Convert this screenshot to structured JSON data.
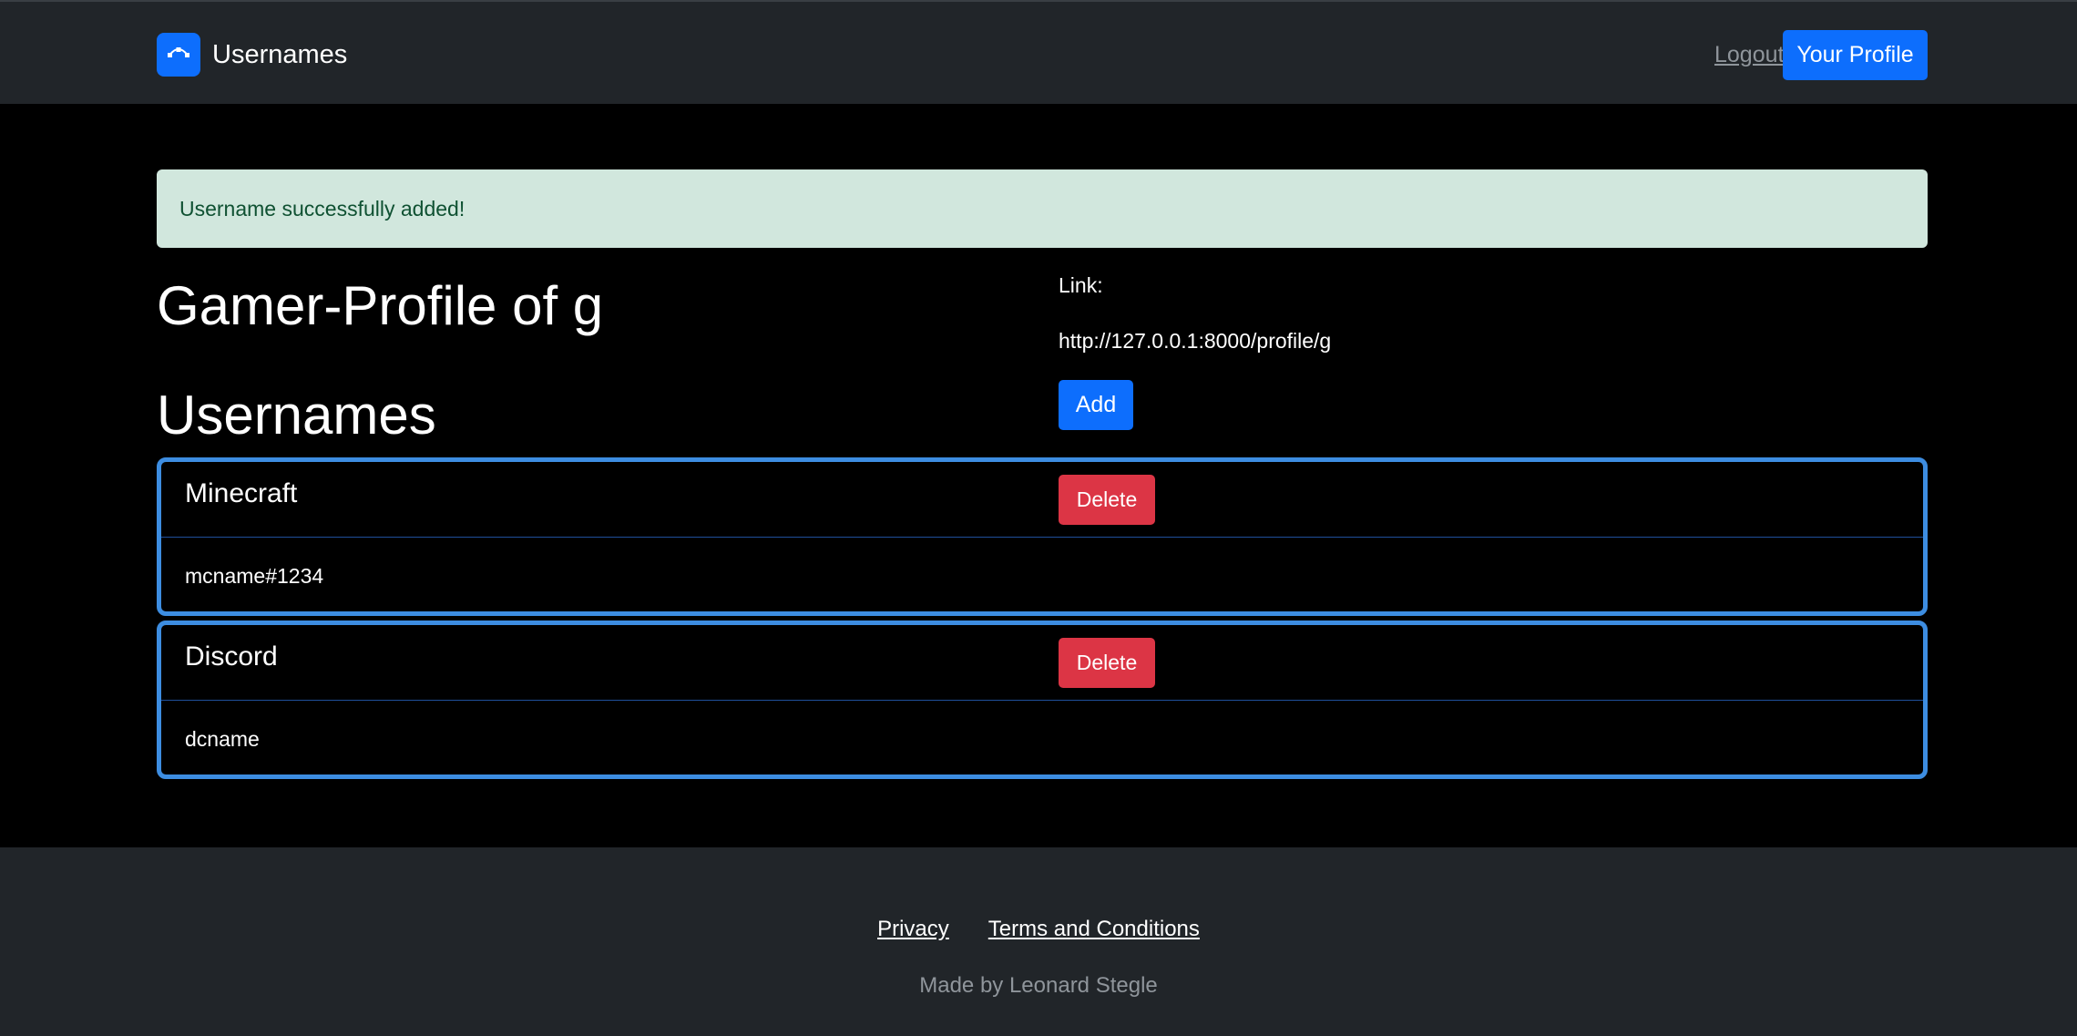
{
  "navbar": {
    "brand_name": "Usernames",
    "brand_icon": "bezier-curve-icon",
    "logout_label": "Logout",
    "profile_button_label": "Your Profile"
  },
  "alert": {
    "message": "Username successfully added!"
  },
  "profile": {
    "title": "Gamer-Profile of g",
    "link_label": "Link:",
    "link_url": "http://127.0.0.1:8000/profile/g",
    "add_button_label": "Add"
  },
  "usernames": {
    "heading": "Usernames",
    "items": [
      {
        "platform": "Minecraft",
        "username": "mcname#1234",
        "delete_label": "Delete"
      },
      {
        "platform": "Discord",
        "username": "dcname",
        "delete_label": "Delete"
      }
    ]
  },
  "footer": {
    "links": [
      "Privacy",
      "Terms and Conditions"
    ],
    "credit": "Made by Leonard Stegle"
  },
  "colors": {
    "primary": "#0d6efd",
    "danger": "#dc3545",
    "navbar_bg": "#212529",
    "alert_bg": "#d1e7dd",
    "alert_text": "#0f5132",
    "card_border": "#3d8de1"
  }
}
